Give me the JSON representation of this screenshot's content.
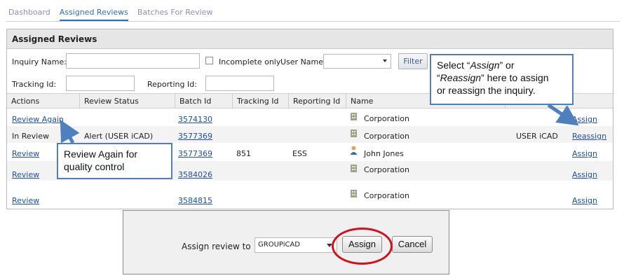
{
  "tabs": [
    {
      "label": "Dashboard"
    },
    {
      "label": "Assigned Reviews"
    },
    {
      "label": "Batches For Review"
    }
  ],
  "panel": {
    "title": "Assigned Reviews",
    "filters": {
      "inquiry_name_label": "Inquiry Name:",
      "inquiry_name_value": "",
      "incomplete_only_label": "Incomplete only",
      "incomplete_only_checked": false,
      "user_name_label": "User Name",
      "user_name_value": "",
      "filter_button": "Filter",
      "tracking_id_label": "Tracking Id:",
      "tracking_id_value": "",
      "reporting_id_label": "Reporting Id:",
      "reporting_id_value": ""
    },
    "columns": [
      "Actions",
      "Review Status",
      "Batch Id",
      "Tracking Id",
      "Reporting Id",
      "Name",
      "",
      ""
    ],
    "rows": [
      {
        "action": "Review Again",
        "status": "",
        "batch_id": "3574130",
        "tracking_id": "",
        "reporting_id": "",
        "name": "Corporation",
        "name_icon": "building-icon",
        "user": "",
        "assign": "Assign"
      },
      {
        "action": "In Review",
        "status": "Alert (USER iCAD)",
        "batch_id": "3577369",
        "tracking_id": "",
        "reporting_id": "",
        "name": "Corporation",
        "name_icon": "building-icon",
        "user": "USER iCAD",
        "assign": "Reassign"
      },
      {
        "action": "Review",
        "status": "",
        "batch_id": "3577369",
        "tracking_id": "851",
        "reporting_id": "ESS",
        "name": "John Jones",
        "name_icon": "person-icon",
        "user": "",
        "assign": "Assign"
      },
      {
        "action": "Review",
        "status": "",
        "batch_id": "3584026",
        "tracking_id": "",
        "reporting_id": "",
        "name": "Corporation",
        "name_icon": "building-icon",
        "user": "",
        "assign": "Assign"
      },
      {
        "action": "Review",
        "status": "",
        "batch_id": "3584815",
        "tracking_id": "",
        "reporting_id": "",
        "name": "Corporation",
        "name_icon": "building-icon",
        "user": "",
        "assign": "Assign"
      }
    ]
  },
  "callouts": {
    "assign_line1_pre": "Select “",
    "assign_line1_em": "Assign",
    "assign_line1_post": "” or",
    "assign_line2_pre": "“",
    "assign_line2_em": "Reassign",
    "assign_line2_post": "” here to assign",
    "assign_line3": "or reassign the inquiry.",
    "review_line1": "Review Again for",
    "review_line2": "quality control"
  },
  "dialog": {
    "label": "Assign review to",
    "selected": "GROUPiCAD",
    "assign_button": "Assign",
    "cancel_button": "Cancel"
  },
  "colors": {
    "link": "#1f4fa8",
    "callout_border": "#4f7fbf",
    "highlight_ring": "#d0121a",
    "active_tab": "#2f6fb5"
  }
}
